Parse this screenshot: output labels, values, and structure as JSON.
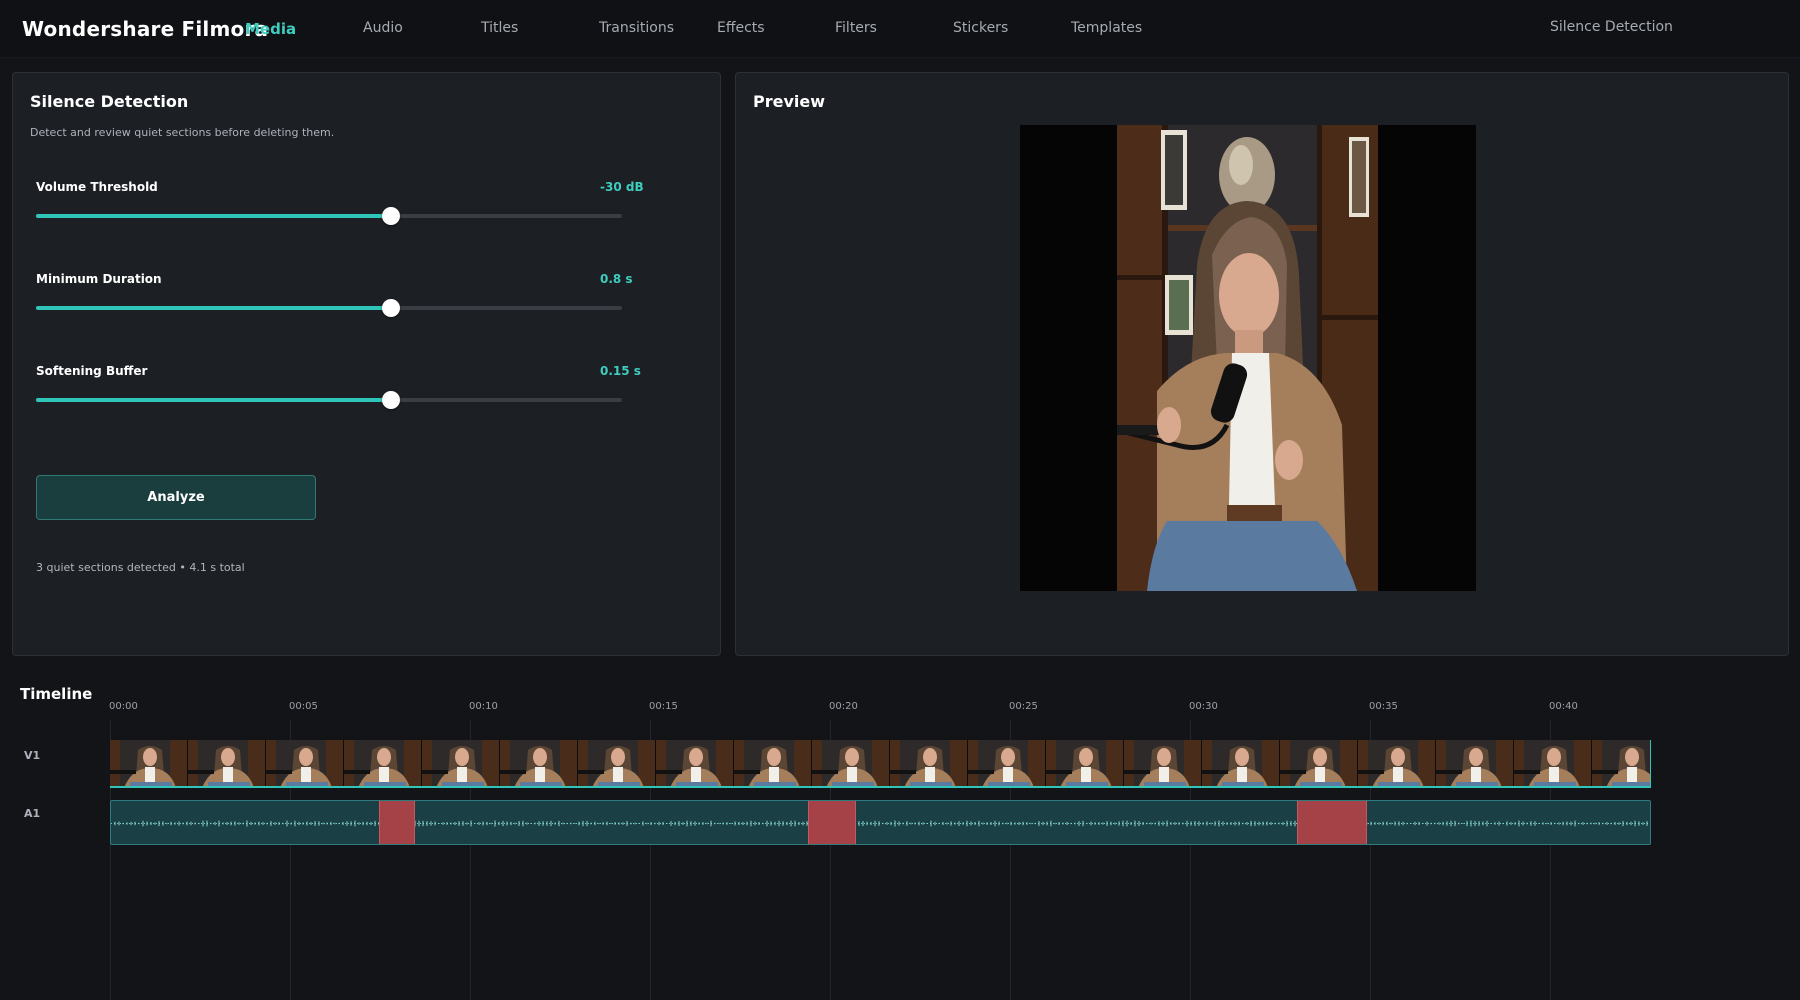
{
  "app": {
    "title": "Wondershare Filmora",
    "media_label": "Media",
    "right_link": "Silence Detection",
    "nav": [
      "Audio",
      "Titles",
      "Transitions",
      "Effects",
      "Filters",
      "Stickers",
      "Templates"
    ]
  },
  "colors": {
    "accent": "#3ecdbe",
    "silence": "#a54248",
    "audio_track": "#1a3f45",
    "background": "#121418"
  },
  "silence_panel": {
    "title": "Silence Detection",
    "subtitle": "Detect and review quiet sections before deleting them.",
    "params": [
      {
        "label": "Volume Threshold",
        "value": "-30 dB",
        "level": 0.605
      },
      {
        "label": "Minimum Duration",
        "value": "0.8 s",
        "level": 0.605
      },
      {
        "label": "Softening Buffer",
        "value": "0.15 s",
        "level": 0.605
      }
    ],
    "analyze_label": "Analyze",
    "summary": "3 quiet sections detected • 4.1 s total"
  },
  "preview": {
    "title": "Preview"
  },
  "timeline": {
    "title": "Timeline",
    "tracks": {
      "video": "V1",
      "audio": "A1"
    },
    "ticks": [
      "00:00",
      "00:05",
      "00:10",
      "00:15",
      "00:20",
      "00:25",
      "00:30",
      "00:35",
      "00:40"
    ],
    "duration_seconds": 42.8,
    "silences": [
      {
        "start": 7.45,
        "end": 8.45
      },
      {
        "start": 19.35,
        "end": 20.7
      },
      {
        "start": 32.95,
        "end": 34.9
      }
    ]
  }
}
